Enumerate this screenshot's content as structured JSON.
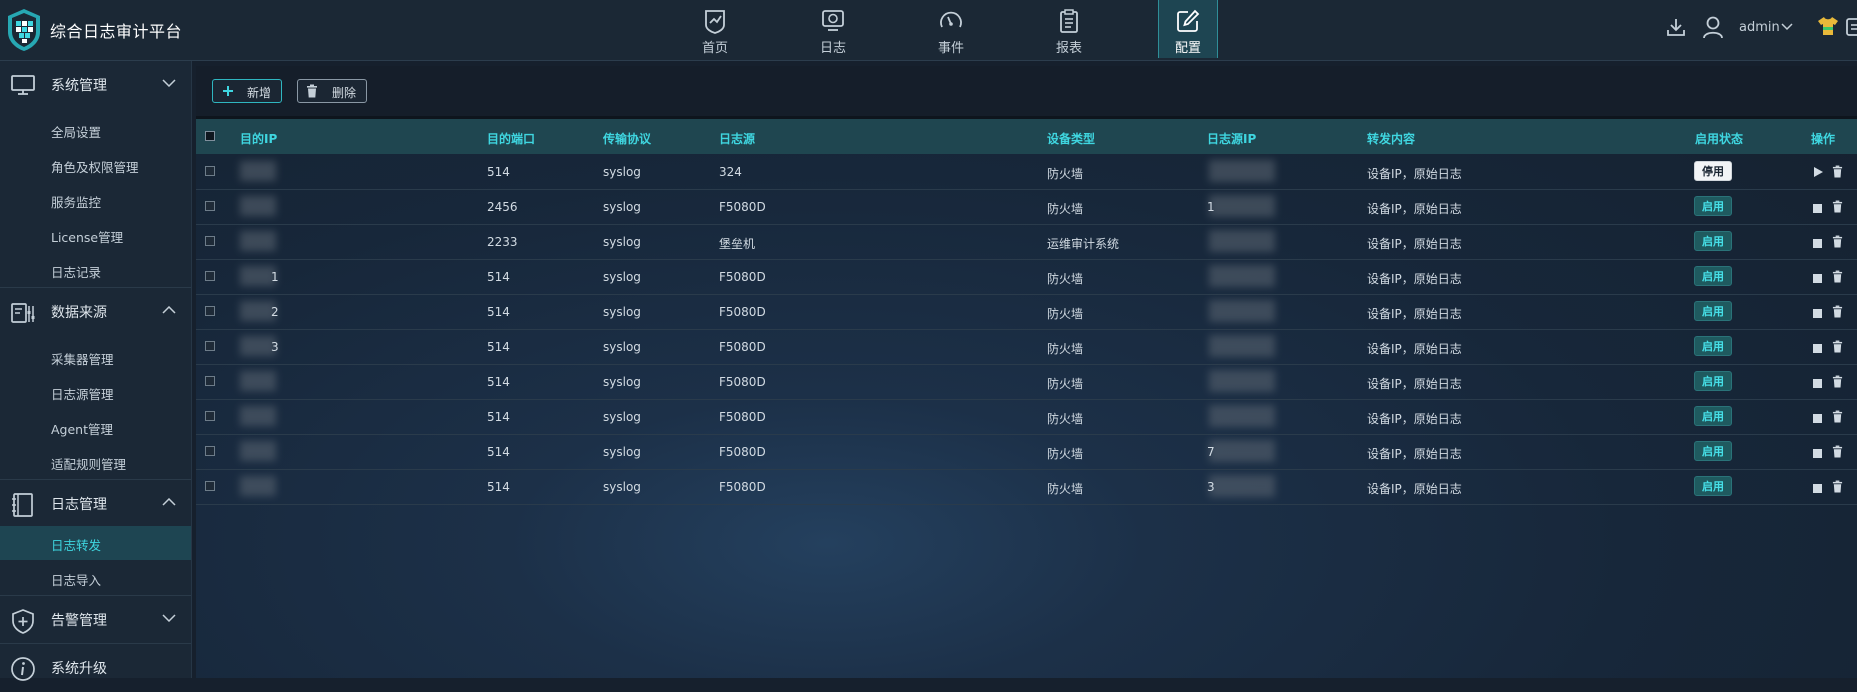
{
  "app": {
    "title": "综合日志审计平台"
  },
  "nav": {
    "items": [
      {
        "label": "首页",
        "icon": "dashboard-icon",
        "active": false
      },
      {
        "label": "日志",
        "icon": "log-monitor-icon",
        "active": false
      },
      {
        "label": "事件",
        "icon": "gauge-icon",
        "active": false
      },
      {
        "label": "报表",
        "icon": "clipboard-icon",
        "active": false
      },
      {
        "label": "配置",
        "icon": "edit-config-icon",
        "active": true
      }
    ]
  },
  "user": {
    "name": "admin"
  },
  "sidebar": {
    "groups": [
      {
        "title": "系统管理",
        "icon": "monitor-icon",
        "expanded": true,
        "items": [
          "全局设置",
          "角色及权限管理",
          "服务监控",
          "License管理",
          "日志记录"
        ]
      },
      {
        "title": "数据来源",
        "icon": "data-source-icon",
        "expanded": true,
        "items": [
          "采集器管理",
          "日志源管理",
          "Agent管理",
          "适配规则管理"
        ]
      },
      {
        "title": "日志管理",
        "icon": "notebook-icon",
        "expanded": true,
        "items": [
          "日志转发",
          "日志导入"
        ],
        "active_item": "日志转发"
      },
      {
        "title": "告警管理",
        "icon": "shield-plus-icon",
        "expanded": false,
        "items": []
      },
      {
        "title": "系统升级",
        "icon": "info-icon",
        "expanded": false,
        "items": []
      }
    ]
  },
  "toolbar": {
    "add_label": "新增",
    "delete_label": "删除"
  },
  "table": {
    "columns": [
      "目的IP",
      "目的端口",
      "传输协议",
      "日志源",
      "设备类型",
      "日志源IP",
      "转发内容",
      "启用状态",
      "操作"
    ],
    "rows": [
      {
        "dest_ip_partial": "",
        "port": "514",
        "protocol": "syslog",
        "source": "324",
        "device_type": "防火墙",
        "source_ip_partial": "",
        "content": "设备IP，原始日志",
        "status": "停用"
      },
      {
        "dest_ip_partial": "",
        "port": "2456",
        "protocol": "syslog",
        "source": "F5080D",
        "device_type": "防火墙",
        "source_ip_partial": "1",
        "content": "设备IP，原始日志",
        "status": "启用"
      },
      {
        "dest_ip_partial": "",
        "port": "2233",
        "protocol": "syslog",
        "source": "堡垒机",
        "device_type": "运维审计系统",
        "source_ip_partial": "",
        "content": "设备IP，原始日志",
        "status": "启用"
      },
      {
        "dest_ip_partial": "1",
        "port": "514",
        "protocol": "syslog",
        "source": "F5080D",
        "device_type": "防火墙",
        "source_ip_partial": "",
        "content": "设备IP，原始日志",
        "status": "启用"
      },
      {
        "dest_ip_partial": "2",
        "port": "514",
        "protocol": "syslog",
        "source": "F5080D",
        "device_type": "防火墙",
        "source_ip_partial": "",
        "content": "设备IP，原始日志",
        "status": "启用"
      },
      {
        "dest_ip_partial": "3",
        "port": "514",
        "protocol": "syslog",
        "source": "F5080D",
        "device_type": "防火墙",
        "source_ip_partial": "",
        "content": "设备IP，原始日志",
        "status": "启用"
      },
      {
        "dest_ip_partial": "",
        "port": "514",
        "protocol": "syslog",
        "source": "F5080D",
        "device_type": "防火墙",
        "source_ip_partial": "",
        "content": "设备IP，原始日志",
        "status": "启用"
      },
      {
        "dest_ip_partial": "",
        "port": "514",
        "protocol": "syslog",
        "source": "F5080D",
        "device_type": "防火墙",
        "source_ip_partial": "",
        "content": "设备IP，原始日志",
        "status": "启用"
      },
      {
        "dest_ip_partial": "",
        "port": "514",
        "protocol": "syslog",
        "source": "F5080D",
        "device_type": "防火墙",
        "source_ip_partial": "7",
        "content": "设备IP，原始日志",
        "status": "启用"
      },
      {
        "dest_ip_partial": "",
        "port": "514",
        "protocol": "syslog",
        "source": "F5080D",
        "device_type": "防火墙",
        "source_ip_partial": "3",
        "content": "设备IP，原始日志",
        "status": "启用"
      }
    ]
  },
  "colors": {
    "accent": "#3fd6e0",
    "active_bg": "#1e4552",
    "header_bg": "#1f4650",
    "page_bg": "#16202d"
  }
}
